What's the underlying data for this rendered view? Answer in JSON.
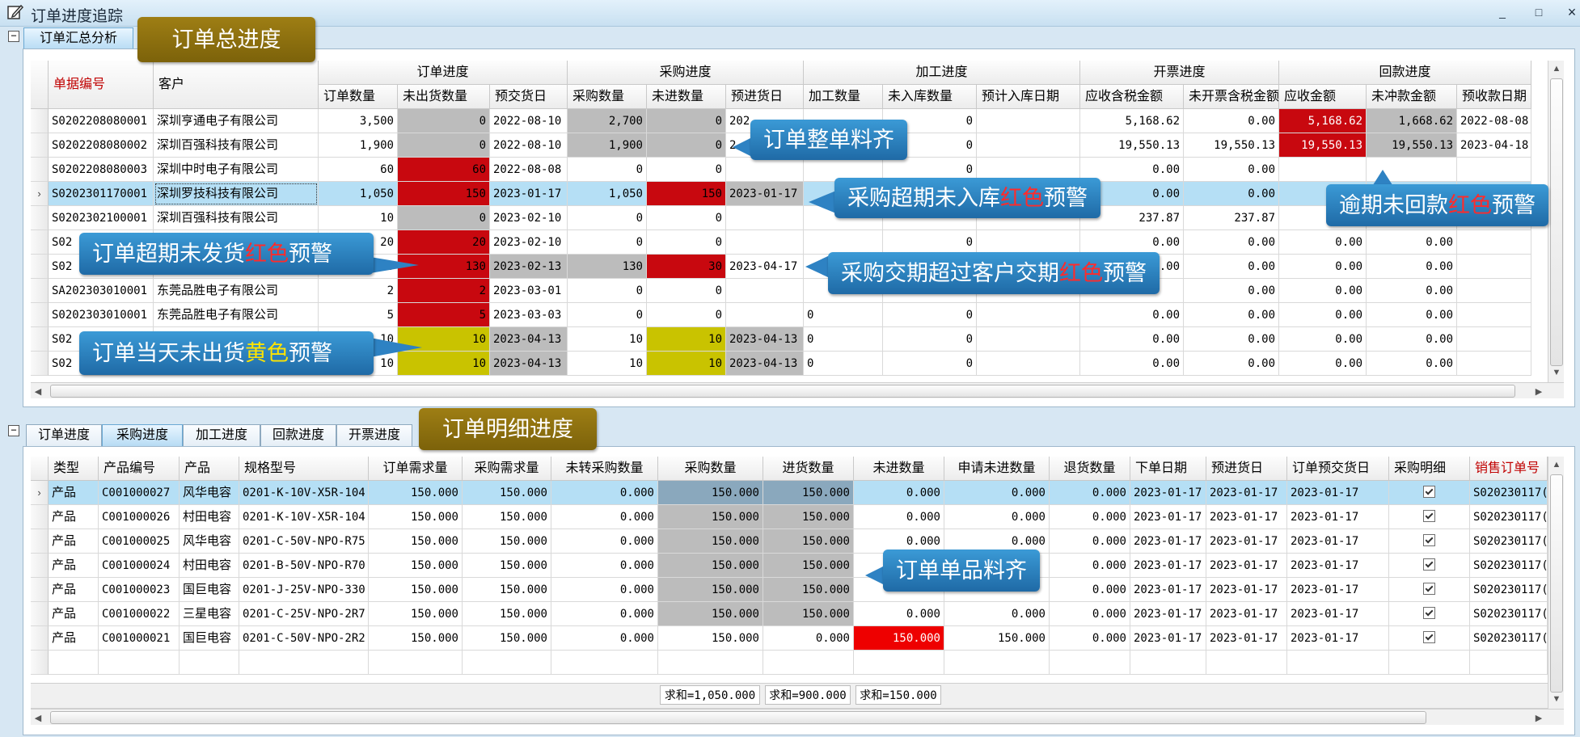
{
  "window": {
    "title": "订单进度追踪",
    "minimize": "_",
    "maximize": "□",
    "close": "×"
  },
  "top": {
    "tab": "订单汇总分析",
    "groups": [
      "订单进度",
      "采购进度",
      "加工进度",
      "开票进度",
      "回款进度"
    ],
    "fixed_headers": [
      "单据编号",
      "客户"
    ],
    "subheaders": [
      "订单数量",
      "未出货数量",
      "预交货日",
      "采购数量",
      "未进数量",
      "预进货日",
      "加工数量",
      "未入库数量",
      "预计入库日期",
      "应收含税金额",
      "未开票含税金额",
      "应收金额",
      "未冲款金额",
      "预收款日期"
    ],
    "rows": [
      [
        "S0202208080001",
        "深圳亨通电子有限公司",
        "3,500",
        "0",
        "2022-08-10",
        "2,700",
        "0",
        "202",
        "",
        "0",
        "",
        "5,168.62",
        "0.00",
        "5,168.62",
        "1,668.62",
        "2022-08-08"
      ],
      [
        "S0202208080002",
        "深圳百强科技有限公司",
        "1,900",
        "0",
        "2022-08-10",
        "1,900",
        "0",
        "2",
        "",
        "0",
        "",
        "19,550.13",
        "19,550.13",
        "19,550.13",
        "19,550.13",
        "2023-04-18"
      ],
      [
        "S0202208080003",
        "深圳中时电子有限公司",
        "60",
        "60",
        "2022-08-08",
        "0",
        "0",
        "",
        "",
        "0",
        "",
        "0.00",
        "0.00",
        "",
        "",
        ""
      ],
      [
        "S0202301170001",
        "深圳罗技科技有限公司",
        "1,050",
        "150",
        "2023-01-17",
        "1,050",
        "150",
        "2023-01-17",
        "",
        "",
        "",
        "0.00",
        "0.00",
        "",
        "",
        ""
      ],
      [
        "S0202302100001",
        "深圳百强科技有限公司",
        "10",
        "0",
        "2023-02-10",
        "0",
        "0",
        "",
        "",
        "",
        "",
        "237.87",
        "237.87",
        "",
        "",
        ""
      ],
      [
        "S02",
        "",
        "20",
        "20",
        "2023-02-10",
        "0",
        "0",
        "",
        "",
        "0",
        "",
        "0.00",
        "0.00",
        "0.00",
        "0.00",
        ""
      ],
      [
        "S02",
        "",
        "30",
        "130",
        "2023-02-13",
        "130",
        "30",
        "2023-04-17",
        "",
        "",
        "",
        "0.00",
        "0.00",
        "0.00",
        "0.00",
        ""
      ],
      [
        "SA202303010001",
        "东莞品胜电子有限公司",
        "2",
        "2",
        "2023-03-01",
        "0",
        "0",
        "",
        "",
        "",
        "",
        "",
        "0.00",
        "0.00",
        "0.00",
        ""
      ],
      [
        "S0202303010001",
        "东莞品胜电子有限公司",
        "5",
        "5",
        "2023-03-03",
        "0",
        "0",
        "",
        "0",
        "0",
        "",
        "0.00",
        "0.00",
        "0.00",
        "0.00",
        ""
      ],
      [
        "S02",
        "",
        "10",
        "10",
        "2023-04-13",
        "10",
        "10",
        "2023-04-13",
        "0",
        "0",
        "",
        "0.00",
        "0.00",
        "0.00",
        "0.00",
        ""
      ],
      [
        "S02",
        "",
        "10",
        "10",
        "2023-04-13",
        "10",
        "10",
        "2023-04-13",
        "0",
        "0",
        "",
        "0.00",
        "0.00",
        "0.00",
        "0.00",
        ""
      ]
    ]
  },
  "bottom": {
    "tabs": [
      "订单进度",
      "采购进度",
      "加工进度",
      "回款进度",
      "开票进度"
    ],
    "headers": [
      "类型",
      "产品编号",
      "产品",
      "规格型号",
      "订单需求量",
      "采购需求量",
      "未转采购数量",
      "采购数量",
      "进货数量",
      "未进数量",
      "申请未进数量",
      "退货数量",
      "下单日期",
      "预进货日",
      "订单预交货日",
      "采购明细",
      "销售订单号"
    ],
    "rows": [
      [
        "产品",
        "C001000027",
        "风华电容",
        "0201-K-10V-X5R-104",
        "150.000",
        "150.000",
        "0.000",
        "150.000",
        "150.000",
        "0.000",
        "0.000",
        "0.000",
        "2023-01-17",
        "2023-01-17",
        "2023-01-17",
        "",
        "S020230117("
      ],
      [
        "产品",
        "C001000026",
        "村田电容",
        "0201-K-10V-X5R-104",
        "150.000",
        "150.000",
        "0.000",
        "150.000",
        "150.000",
        "0.000",
        "0.000",
        "0.000",
        "2023-01-17",
        "2023-01-17",
        "2023-01-17",
        "",
        "S020230117("
      ],
      [
        "产品",
        "C001000025",
        "风华电容",
        "0201-C-50V-NPO-R75",
        "150.000",
        "150.000",
        "0.000",
        "150.000",
        "150.000",
        "0.000",
        "0.000",
        "0.000",
        "2023-01-17",
        "2023-01-17",
        "2023-01-17",
        "",
        "S020230117("
      ],
      [
        "产品",
        "C001000024",
        "村田电容",
        "0201-B-50V-NPO-R70",
        "150.000",
        "150.000",
        "0.000",
        "150.000",
        "150.000",
        "",
        "",
        "0.000",
        "2023-01-17",
        "2023-01-17",
        "2023-01-17",
        "",
        "S020230117("
      ],
      [
        "产品",
        "C001000023",
        "国巨电容",
        "0201-J-25V-NPO-330",
        "150.000",
        "150.000",
        "0.000",
        "150.000",
        "150.000",
        "",
        "",
        "0.000",
        "2023-01-17",
        "2023-01-17",
        "2023-01-17",
        "",
        "S020230117("
      ],
      [
        "产品",
        "C001000022",
        "三星电容",
        "0201-C-25V-NPO-2R7",
        "150.000",
        "150.000",
        "0.000",
        "150.000",
        "150.000",
        "0.000",
        "0.000",
        "0.000",
        "2023-01-17",
        "2023-01-17",
        "2023-01-17",
        "",
        "S020230117("
      ],
      [
        "产品",
        "C001000021",
        "国巨电容",
        "0201-C-50V-NPO-2R2",
        "150.000",
        "150.000",
        "0.000",
        "150.000",
        "0.000",
        "150.000",
        "150.000",
        "0.000",
        "2023-01-17",
        "2023-01-17",
        "2023-01-17",
        "",
        "S020230117("
      ]
    ],
    "sums": [
      "求和=1,050.000",
      "求和=900.000",
      "求和=150.000"
    ]
  },
  "callouts": {
    "order_total": "订单总进度",
    "order_detail": "订单明细进度",
    "full_kit": "订单整单料齐",
    "overdue_purchase_pre": "采购超期未入库",
    "overdue_purchase_red": "红色",
    "overdue_purchase_post": "预警",
    "overdue_payment_pre": "逾期未回款",
    "overdue_payment_red": "红色",
    "overdue_payment_post": "预警",
    "overdue_ship_pre": "订单超期未发货",
    "overdue_ship_red": "红色",
    "overdue_ship_post": "预警",
    "purchase_late_pre": "采购交期超过客户交期",
    "purchase_late_red": "红色",
    "purchase_late_post": "预警",
    "today_ship_pre": "订单当天未出货",
    "today_ship_yellow": "黄色",
    "today_ship_post": "预警",
    "single_kit": "订单单品料齐"
  },
  "colors": {
    "red": "#c8080f",
    "gray": "#bcbcbc",
    "yellow": "#c9c300",
    "selected": "#b5dff5",
    "header_red": "#c00000",
    "sum_red": "#ee0000"
  }
}
